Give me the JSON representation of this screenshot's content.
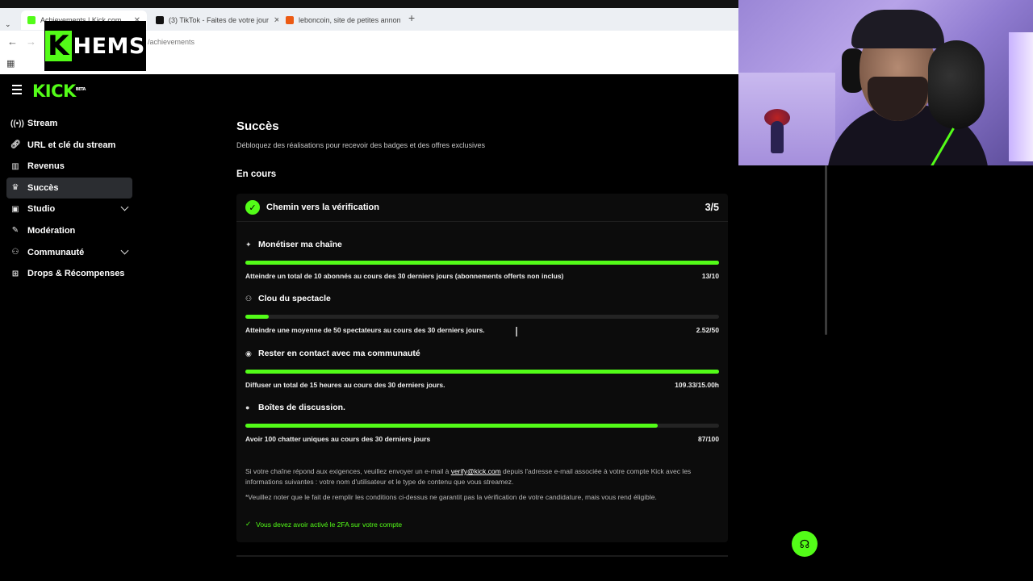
{
  "browser": {
    "tabs": [
      {
        "label": "Achievements | Kick.com"
      },
      {
        "label": "(3) TikTok - Faites de votre jour"
      },
      {
        "label": "leboncoin, site de petites annon"
      }
    ],
    "url": "/achievements",
    "new_tab": "+"
  },
  "overlay": {
    "logo_k": "K",
    "logo_rest": "HEMS"
  },
  "kick": {
    "logo": "KICK",
    "beta": "BETA"
  },
  "sidebar": {
    "items": [
      {
        "label": "Stream",
        "icon": "stream-icon"
      },
      {
        "label": "URL et clé du stream",
        "icon": "link-icon"
      },
      {
        "label": "Revenus",
        "icon": "chart-icon"
      },
      {
        "label": "Succès",
        "icon": "trophy-icon"
      },
      {
        "label": "Studio",
        "icon": "studio-icon"
      },
      {
        "label": "Modération",
        "icon": "wrench-icon"
      },
      {
        "label": "Communauté",
        "icon": "community-icon"
      },
      {
        "label": "Drops & Récompenses",
        "icon": "drops-icon"
      }
    ]
  },
  "main": {
    "title": "Succès",
    "subtitle": "Débloquez des réalisations pour recevoir des badges et des offres exclusives",
    "section": "En cours",
    "card": {
      "title": "Chemin vers la vérification",
      "score": "3/5",
      "achievements": [
        {
          "title": "Monétiser ma chaîne",
          "icon": "sparkle-icon",
          "desc": "Atteindre un total de 10 abonnés au cours des 30 derniers jours (abonnements offerts non inclus)",
          "value": "13/10",
          "progress": 1.0
        },
        {
          "title": "Clou du spectacle",
          "icon": "people-icon",
          "desc": "Atteindre une moyenne de 50 spectateurs au cours des 30 derniers jours.",
          "value": "2.52/50",
          "progress": 0.05
        },
        {
          "title": "Rester en contact avec ma communauté",
          "icon": "broadcast-icon",
          "desc": "Diffuser un total de 15 heures au cours des 30 derniers jours.",
          "value": "109.33/15.00h",
          "progress": 1.0
        },
        {
          "title": "Boîtes de discussion.",
          "icon": "chat-icon",
          "desc": "Avoir 100 chatter uniques au cours des 30 derniers jours",
          "value": "87/100",
          "progress": 0.87
        }
      ],
      "info_1a": "Si votre chaîne répond aux exigences, veuillez envoyer un e-mail à ",
      "info_email": "verify@kick.com",
      "info_1b": " depuis l'adresse e-mail associée à votre compte Kick avec les informations suivantes : votre nom d'utilisateur et le type de contenu que vous streamez.",
      "info_2": "*Veuillez noter que le fait de remplir les conditions ci-dessus ne garantit pas la vérification de votre candidature, mais vous rend éligible.",
      "twofa": "Vous devez avoir activé le 2FA sur votre compte"
    }
  },
  "colors": {
    "accent": "#53fc18",
    "background": "#000000",
    "card": "#0c0c0c"
  }
}
